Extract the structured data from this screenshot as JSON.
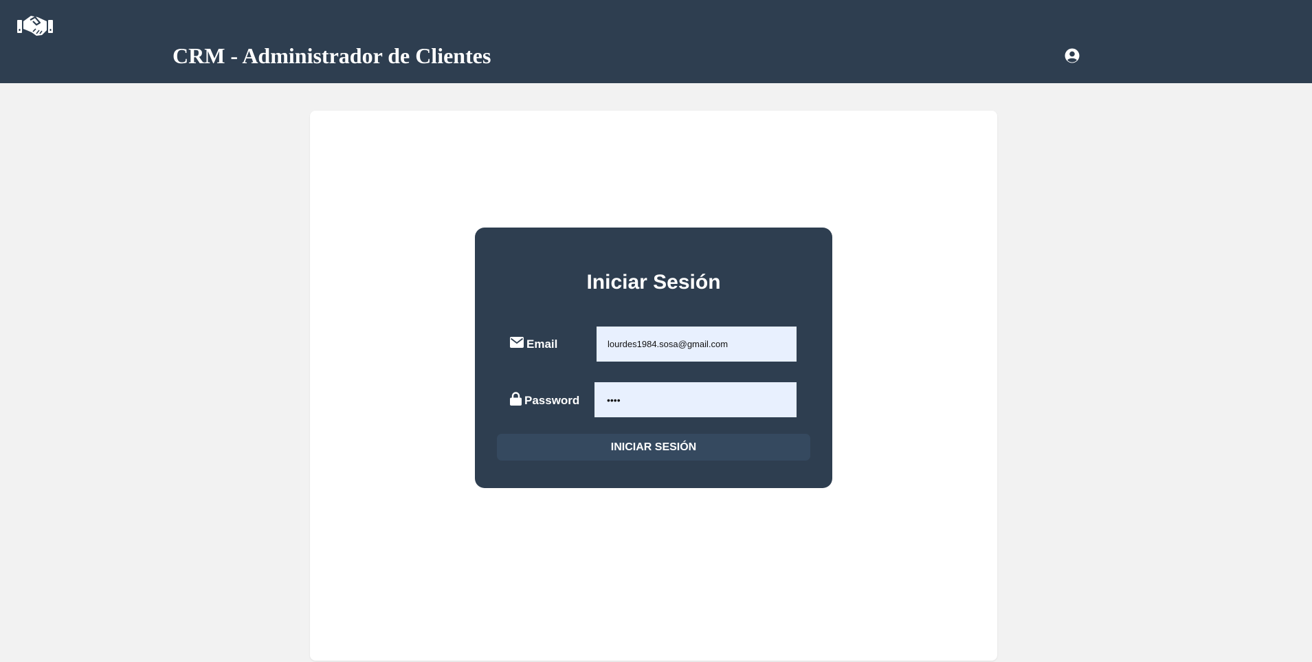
{
  "header": {
    "title": "CRM - Administrador de Clientes",
    "logo_icon": "handshake-icon",
    "user_icon": "user-circle-icon",
    "background": "#2e3e50"
  },
  "login": {
    "title": "Iniciar Sesión",
    "email_label": "Email",
    "email_icon": "envelope-icon",
    "email_value": "lourdes1984.sosa@gmail.com",
    "password_label": "Password",
    "password_icon": "lock-icon",
    "password_value": "••••",
    "submit_label": "INICIAR SESIÓN",
    "input_background": "#e8f0fe",
    "button_background": "#35495f"
  }
}
